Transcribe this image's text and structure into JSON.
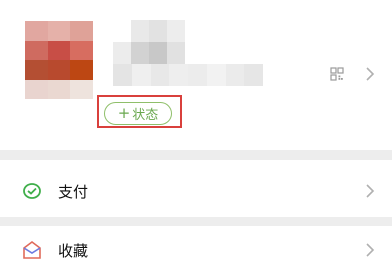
{
  "profile": {
    "status_button": {
      "plus": "+",
      "label": "状态"
    },
    "avatar_colors": [
      "#e1a7a0",
      "#e5b1a9",
      "#dfa298",
      "#cf6b60",
      "#c84e46",
      "#d76d60",
      "#b44f33",
      "#b84a2e",
      "#bd4713",
      "#e9d4cf",
      "#ead8d1",
      "#eee3dd"
    ],
    "name_colors": [
      "#ffffff",
      "#e9e9e9",
      "#e2e2e2",
      "#ededed",
      "#ffffff",
      "#ececec",
      "#d2d2d2",
      "#c8c8c8",
      "#e1e1e1",
      "#ffffff"
    ],
    "id_colors": [
      "#e4e4e4",
      "#efefef",
      "#e8e8e8",
      "#eeeeee",
      "#ececec",
      "#f2f2f2",
      "#ebebeb",
      "#e6e6e6"
    ]
  },
  "menu": {
    "items": [
      {
        "label": "支付",
        "icon": "pay-icon"
      },
      {
        "label": "收藏",
        "icon": "favorites-icon"
      }
    ]
  },
  "colors": {
    "accent_green": "#6aa84f",
    "highlight_red": "#d9403c",
    "separator": "#ededed"
  }
}
